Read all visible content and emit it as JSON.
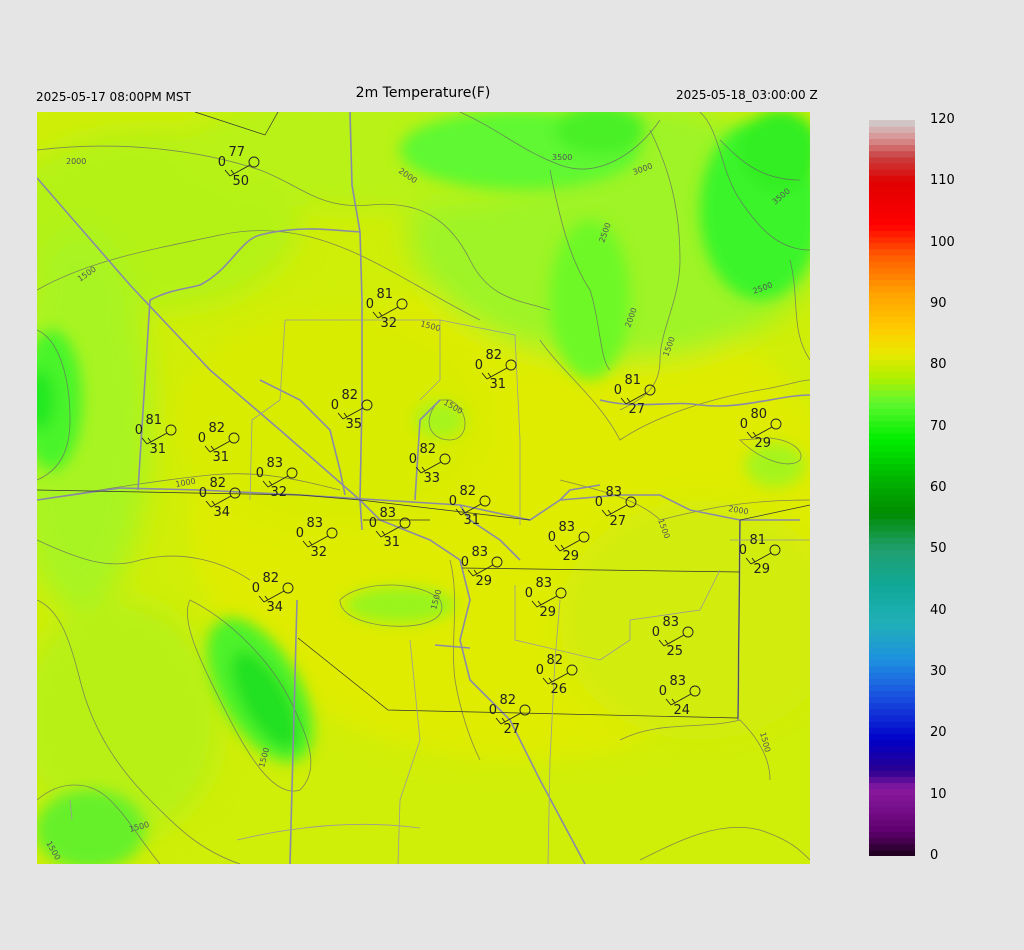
{
  "header": {
    "valid_local": "2025-05-17 08:00PM MST",
    "title": "2m Temperature(F)",
    "valid_utc": "2025-05-18_03:00:00 Z"
  },
  "colorbar": {
    "min": 0,
    "max": 120,
    "tick_labels": [
      "120",
      "110",
      "100",
      "90",
      "80",
      "70",
      "60",
      "50",
      "40",
      "30",
      "20",
      "10",
      "0"
    ],
    "color_stops": [
      {
        "v": 0,
        "c": "#1a0018"
      },
      {
        "v": 4,
        "c": "#5e006e"
      },
      {
        "v": 11,
        "c": "#8a1aa0"
      },
      {
        "v": 14,
        "c": "#2a0090"
      },
      {
        "v": 19,
        "c": "#0000c8"
      },
      {
        "v": 26,
        "c": "#1a50e0"
      },
      {
        "v": 32,
        "c": "#1e90e0"
      },
      {
        "v": 38,
        "c": "#20b0b8"
      },
      {
        "v": 44,
        "c": "#10a898"
      },
      {
        "v": 50,
        "c": "#20a070"
      },
      {
        "v": 56,
        "c": "#008c00"
      },
      {
        "v": 62,
        "c": "#00b800"
      },
      {
        "v": 68,
        "c": "#00ee00"
      },
      {
        "v": 74,
        "c": "#60f830"
      },
      {
        "v": 78,
        "c": "#b0f000"
      },
      {
        "v": 82,
        "c": "#e8e800"
      },
      {
        "v": 86,
        "c": "#ffcc00"
      },
      {
        "v": 92,
        "c": "#ffa000"
      },
      {
        "v": 98,
        "c": "#ff5a00"
      },
      {
        "v": 103,
        "c": "#ff0000"
      },
      {
        "v": 110,
        "c": "#e00000"
      },
      {
        "v": 114,
        "c": "#c84040"
      },
      {
        "v": 117,
        "c": "#d89090"
      },
      {
        "v": 120,
        "c": "#d0d0d0"
      }
    ]
  },
  "contour_labels": [
    "2000",
    "2000",
    "3500",
    "3000",
    "3500",
    "2500",
    "2500",
    "2000",
    "1500",
    "1500",
    "1500",
    "1500",
    "1500",
    "1000",
    "2000",
    "1500",
    "1500",
    "1500",
    "1500",
    "1500"
  ],
  "stations": [
    {
      "temp": "77",
      "top_left": "0",
      "dew": "50"
    },
    {
      "temp": "81",
      "top_left": "0",
      "dew": "32"
    },
    {
      "temp": "82",
      "top_left": "0",
      "dew": "31"
    },
    {
      "temp": "81",
      "top_left": "0",
      "dew": "27"
    },
    {
      "temp": "82",
      "top_left": "0",
      "dew": "35"
    },
    {
      "temp": "81",
      "top_left": "0",
      "dew": "31"
    },
    {
      "temp": "82",
      "top_left": "0",
      "dew": "31"
    },
    {
      "temp": "80",
      "top_left": "0",
      "dew": "29"
    },
    {
      "temp": "82",
      "top_left": "0",
      "dew": "33"
    },
    {
      "temp": "83",
      "top_left": "0",
      "dew": "32"
    },
    {
      "temp": "82",
      "top_left": "0",
      "dew": "34"
    },
    {
      "temp": "82",
      "top_left": "0",
      "dew": "31"
    },
    {
      "temp": "83",
      "top_left": "0",
      "dew": "27"
    },
    {
      "temp": "83",
      "top_left": "0",
      "dew": "31"
    },
    {
      "temp": "83",
      "top_left": "0",
      "dew": "32"
    },
    {
      "temp": "83",
      "top_left": "0",
      "dew": "29"
    },
    {
      "temp": "83",
      "top_left": "0",
      "dew": "29"
    },
    {
      "temp": "81",
      "top_left": "0",
      "dew": "29"
    },
    {
      "temp": "82",
      "top_left": "0",
      "dew": "34"
    },
    {
      "temp": "83",
      "top_left": "0",
      "dew": "29"
    },
    {
      "temp": "83",
      "top_left": "0",
      "dew": "25"
    },
    {
      "temp": "82",
      "top_left": "0",
      "dew": "26"
    },
    {
      "temp": "83",
      "top_left": "0",
      "dew": "24"
    },
    {
      "temp": "82",
      "top_left": "0",
      "dew": "27"
    }
  ]
}
